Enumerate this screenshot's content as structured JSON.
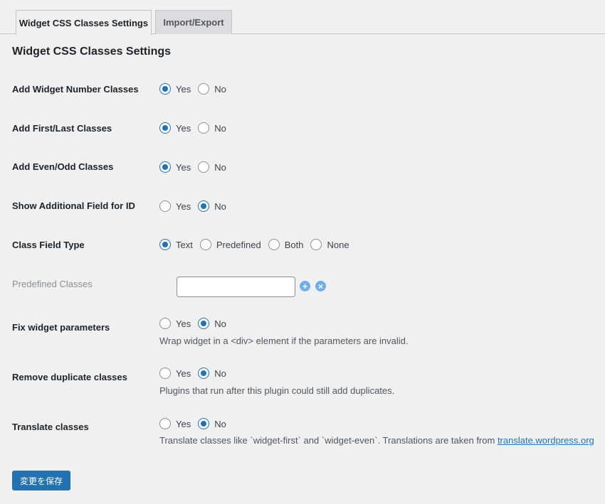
{
  "tabs": [
    {
      "label": "Widget CSS Classes Settings",
      "active": true
    },
    {
      "label": "Import/Export",
      "active": false
    }
  ],
  "section_title": "Widget CSS Classes Settings",
  "rows": {
    "widget_number": {
      "label": "Add Widget Number Classes",
      "options": [
        "Yes",
        "No"
      ],
      "selected": "Yes"
    },
    "first_last": {
      "label": "Add First/Last Classes",
      "options": [
        "Yes",
        "No"
      ],
      "selected": "Yes"
    },
    "even_odd": {
      "label": "Add Even/Odd Classes",
      "options": [
        "Yes",
        "No"
      ],
      "selected": "Yes"
    },
    "show_id": {
      "label": "Show Additional Field for ID",
      "options": [
        "Yes",
        "No"
      ],
      "selected": "No"
    },
    "field_type": {
      "label": "Class Field Type",
      "options": [
        "Text",
        "Predefined",
        "Both",
        "None"
      ],
      "selected": "Text"
    },
    "predefined": {
      "label": "Predefined Classes",
      "value": ""
    },
    "fix_params": {
      "label": "Fix widget parameters",
      "options": [
        "Yes",
        "No"
      ],
      "selected": "No",
      "description": "Wrap widget in a <div> element if the parameters are invalid."
    },
    "remove_dup": {
      "label": "Remove duplicate classes",
      "options": [
        "Yes",
        "No"
      ],
      "selected": "No",
      "description": "Plugins that run after this plugin could still add duplicates."
    },
    "translate": {
      "label": "Translate classes",
      "options": [
        "Yes",
        "No"
      ],
      "selected": "No",
      "description": "Translate classes like `widget-first` and `widget-even`. Translations are taken from ",
      "link_text": "translate.wordpress.org"
    }
  },
  "icons": {
    "add": "plus-circle-icon",
    "remove": "close-circle-icon"
  },
  "save_label": "変更を保存",
  "colors": {
    "accent": "#2271b1",
    "icon_light": "#72aee6",
    "background": "#f0f0f1"
  }
}
